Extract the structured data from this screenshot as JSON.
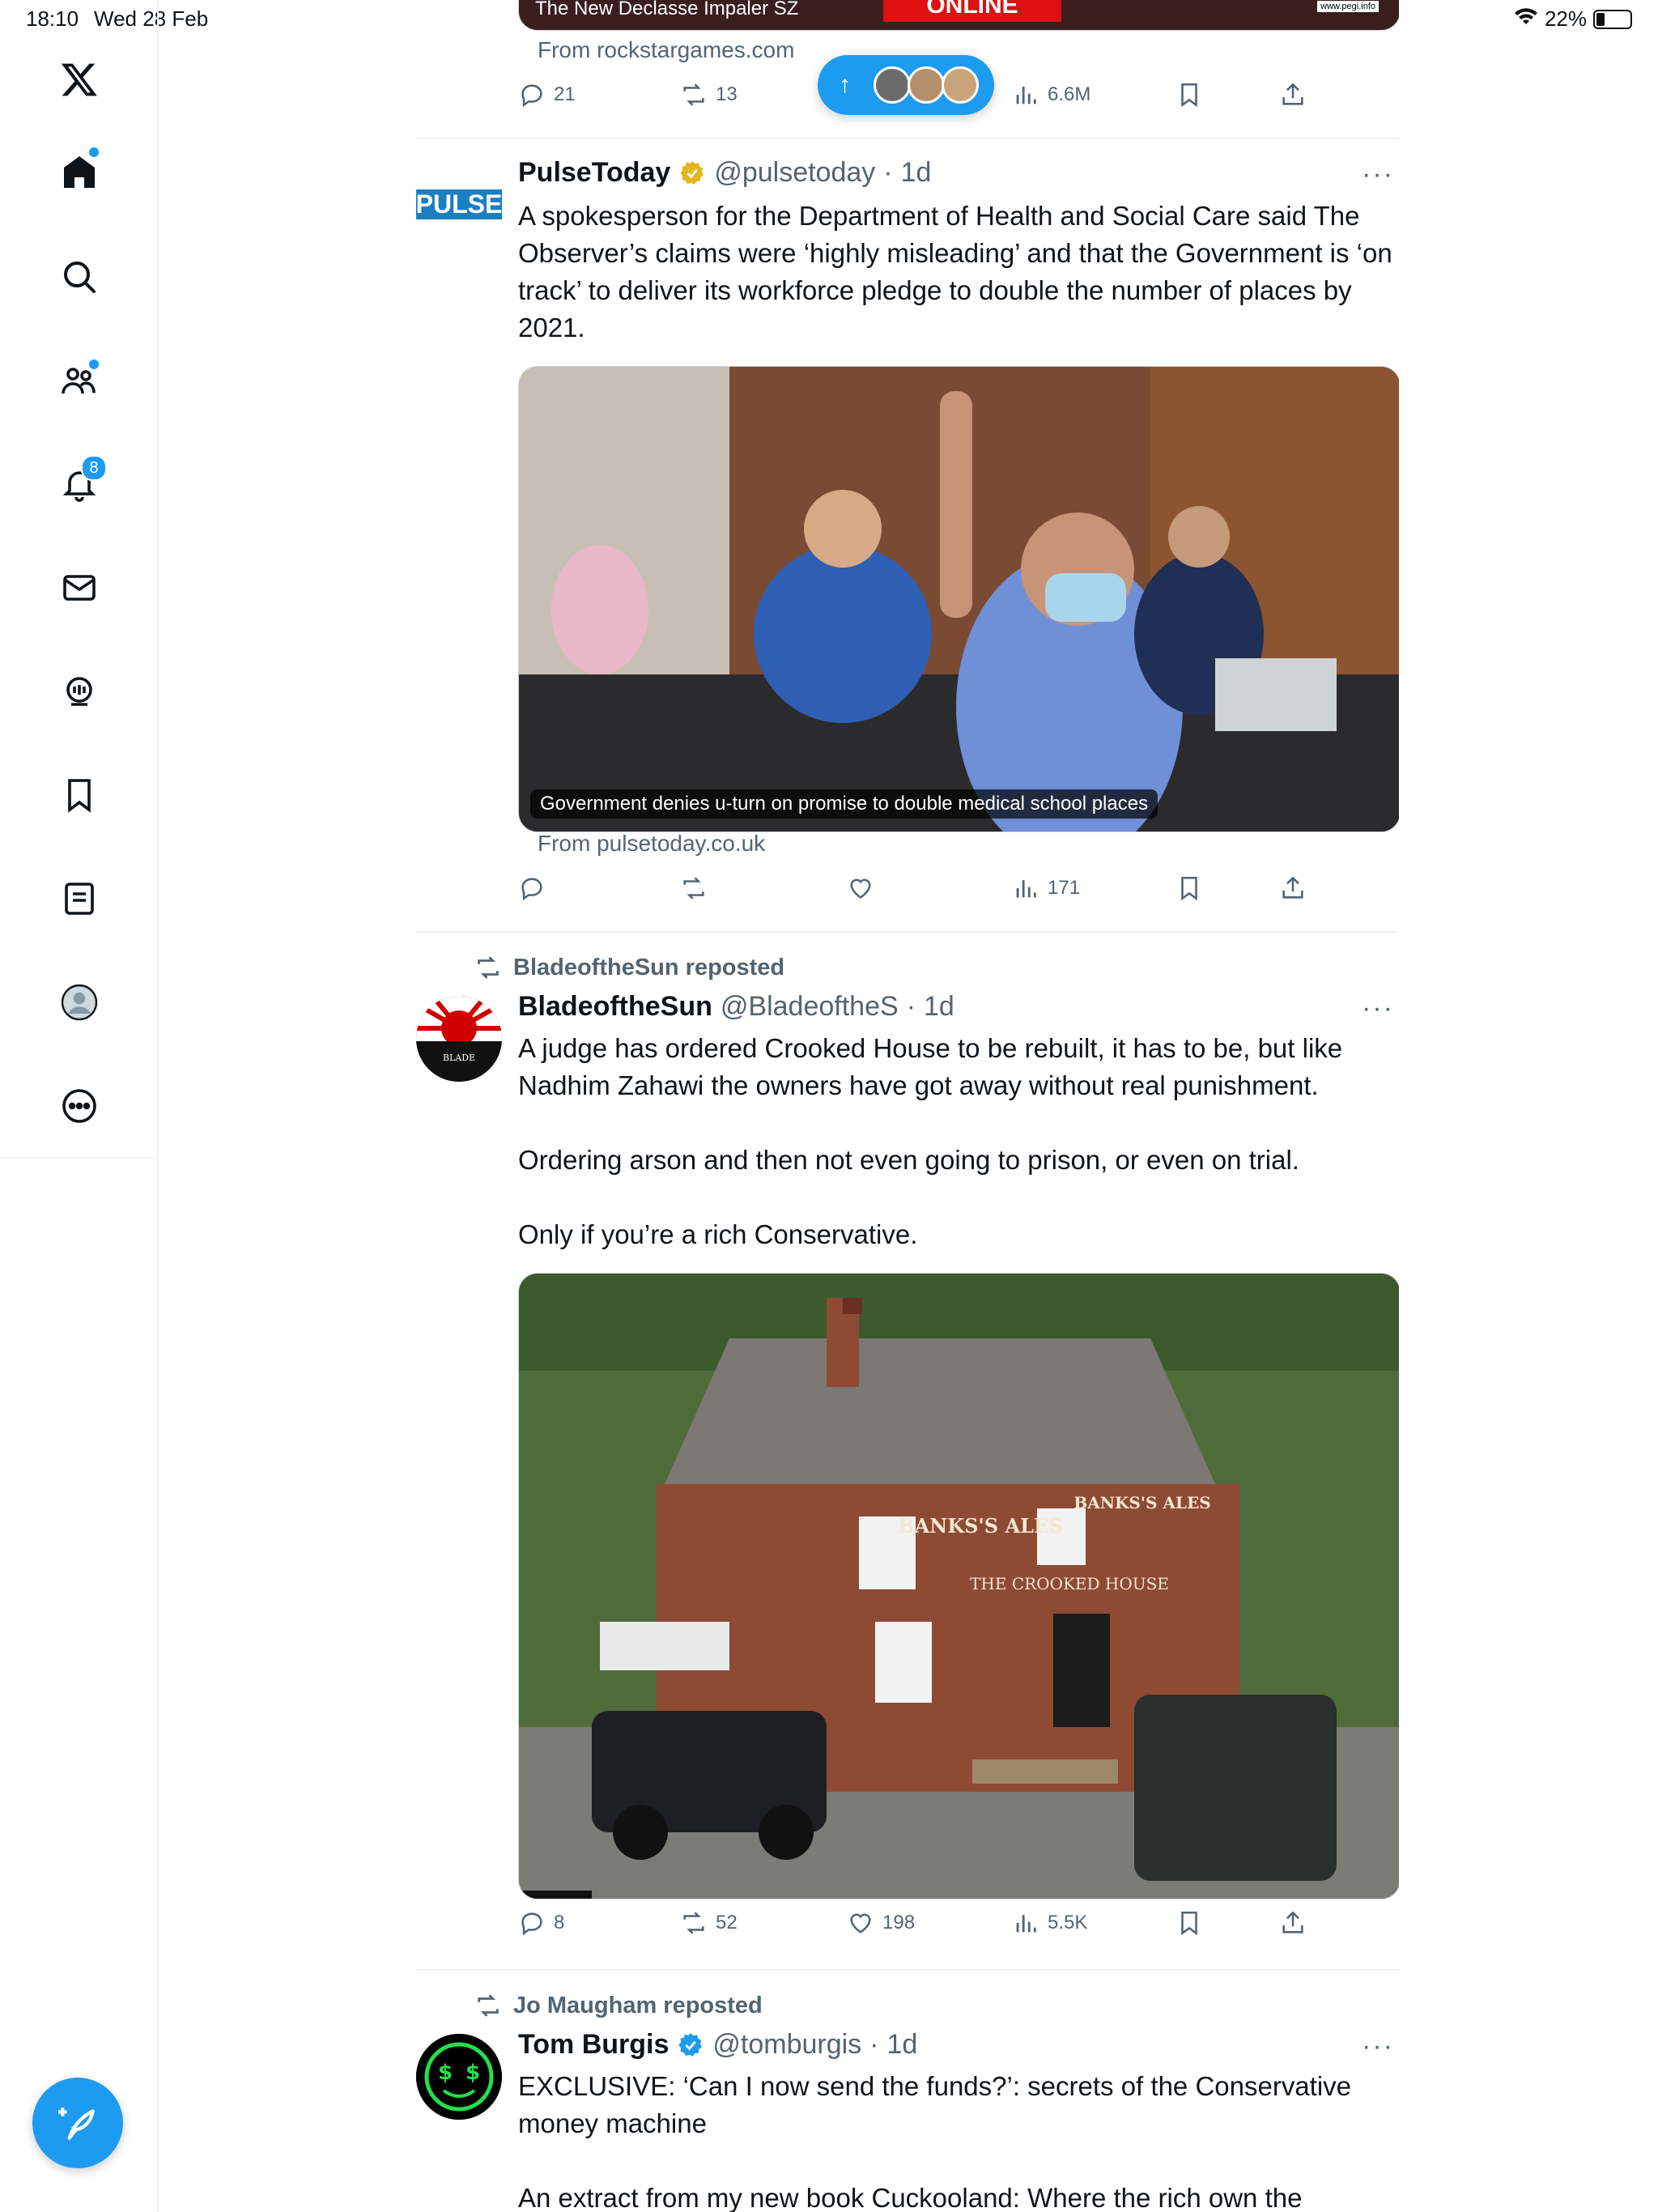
{
  "status_bar": {
    "time": "18:10",
    "date": "Wed 28 Feb",
    "battery": "22%",
    "battery_level": 0.22
  },
  "sidebar": {
    "notifications_badge": "8",
    "items": [
      {
        "name": "home"
      },
      {
        "name": "explore"
      },
      {
        "name": "communities"
      },
      {
        "name": "notifications"
      },
      {
        "name": "messages"
      },
      {
        "name": "grok"
      },
      {
        "name": "bookmarks"
      },
      {
        "name": "lists"
      },
      {
        "name": "profile"
      },
      {
        "name": "more"
      }
    ]
  },
  "banner_top": {
    "caption": "The New Declasse Impaler SZ",
    "rating_text": "ONLINE",
    "pegi": "www.pegi.info"
  },
  "new_posts_pill": {
    "arrow": "↑"
  },
  "posts": [
    {
      "source": "From rockstargames.com",
      "replies": "21",
      "reposts": "13",
      "likes": "",
      "views": "6.6M"
    },
    {
      "avatar_text": "PULSE",
      "name": "PulseToday",
      "handle": "@pulsetoday",
      "time": "1d",
      "text": "A spokesperson for the Department of Health and Social Care said The Observer’s claims were ‘highly misleading’ and that the Government is ‘on track’ to deliver its workforce pledge to double the number of places by 2021.",
      "image_caption": "Government denies u-turn on promise to double medical school places",
      "source": "From pulsetoday.co.uk",
      "replies": "",
      "reposts": "",
      "likes": "",
      "views": "171"
    },
    {
      "reposted_by": "BladeoftheSun reposted",
      "avatar_text": "BLADE OF THE SUN",
      "name": "BladeoftheSun",
      "handle": "@BladeoftheS",
      "time": "1d",
      "text_1": "A judge has ordered Crooked House to be rebuilt, it has to be, but like Nadhim Zahawi the owners have got away without real punishment.",
      "text_2": "Ordering arson and then not even going to prison, or even on trial.",
      "text_3": "Only if you’re a rich Conservative.",
      "image_sign_1": "BANKS'S ALES",
      "image_sign_2": "BANKS'S ALES",
      "image_sign_3": "THE CROOKED HOUSE",
      "replies": "8",
      "reposts": "52",
      "likes": "198",
      "views": "5.5K"
    },
    {
      "reposted_by": "Jo Maugham reposted",
      "name": "Tom Burgis",
      "handle": "@tomburgis",
      "time": "1d",
      "text_1": "EXCLUSIVE: ‘Can I now send the funds?’: secrets of the Conservative money machine",
      "text_2": "An extract from my new book Cuckooland: Where the rich own the"
    }
  ],
  "more_glyph": "···",
  "separator_dot": "·",
  "colors": {
    "accent": "#1d9bf0",
    "muted": "#536471",
    "text": "#0f1419",
    "border": "#eff3f4",
    "verified_gold": "#e2b719"
  }
}
